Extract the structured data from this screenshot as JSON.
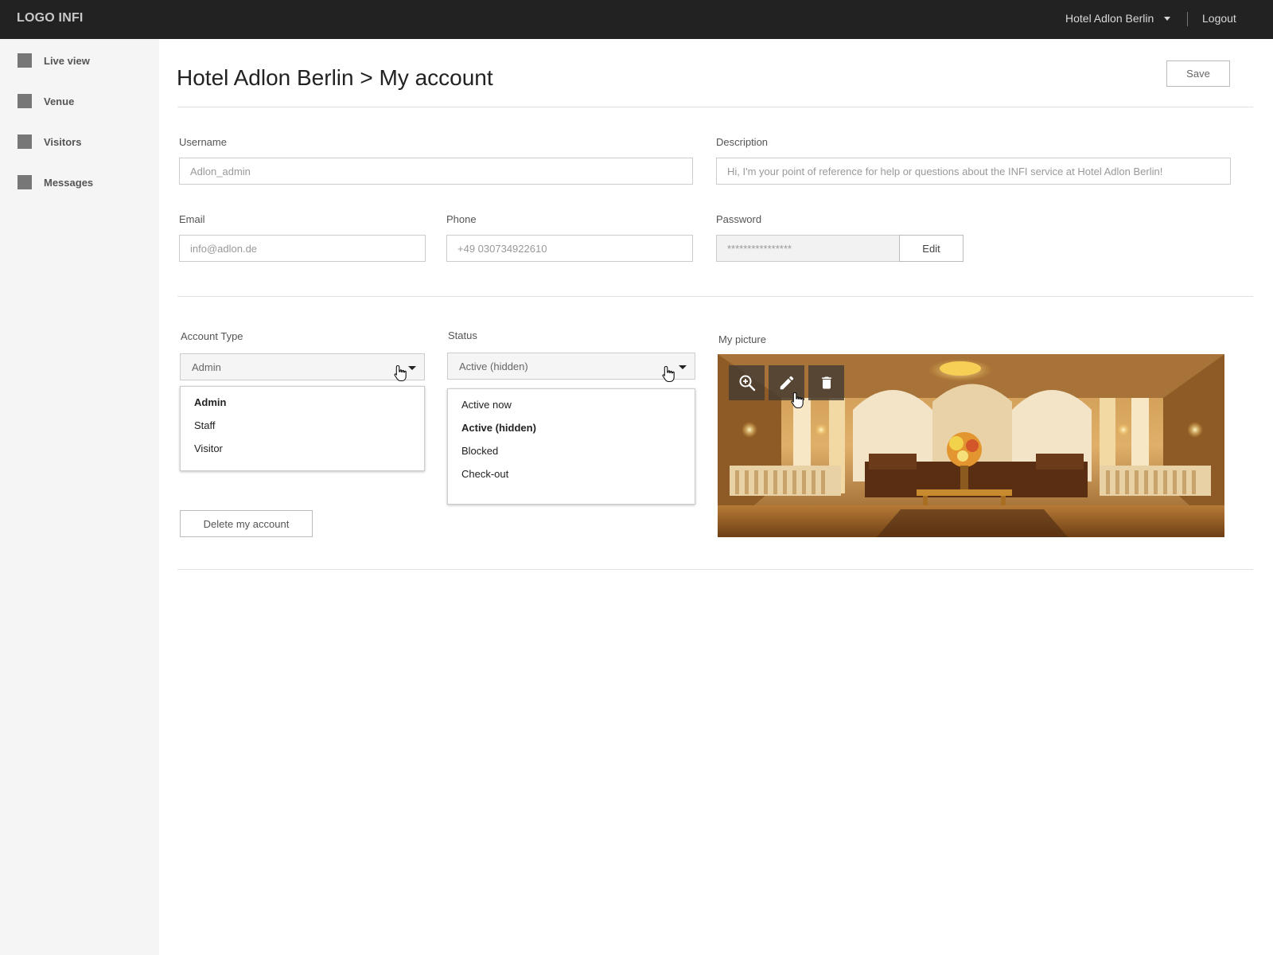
{
  "topbar": {
    "logo": "LOGO INFI",
    "venue_selector": "Hotel Adlon Berlin",
    "logout": "Logout"
  },
  "sidebar": {
    "items": [
      {
        "label": "Live view"
      },
      {
        "label": "Venue"
      },
      {
        "label": "Visitors"
      },
      {
        "label": "Messages"
      }
    ]
  },
  "page": {
    "title": "Hotel Adlon Berlin > My account",
    "save_label": "Save"
  },
  "form": {
    "username": {
      "label": "Username",
      "value": "Adlon_admin"
    },
    "description": {
      "label": "Description",
      "value": "Hi, I'm your point of reference for help or questions about the INFI service at Hotel Adlon Berlin!"
    },
    "email": {
      "label": "Email",
      "value": "info@adlon.de"
    },
    "phone": {
      "label": "Phone",
      "value": "+49 030734922610"
    },
    "password": {
      "label": "Password",
      "value": "****************",
      "edit_label": "Edit"
    }
  },
  "account_type": {
    "label": "Account Type",
    "selected": "Admin",
    "options": [
      "Admin",
      "Staff",
      "Visitor"
    ]
  },
  "status": {
    "label": "Status",
    "selected": "Active (hidden)",
    "options": [
      "Active now",
      "Active (hidden)",
      "Blocked",
      "Check-out"
    ]
  },
  "delete_label": "Delete my account",
  "picture": {
    "label": "My picture",
    "tools": [
      "zoom-in-icon",
      "pencil-icon",
      "trash-icon"
    ]
  },
  "colors": {
    "topbar": "#222222",
    "sidebar": "#f5f5f5",
    "nav_square": "#777777"
  }
}
